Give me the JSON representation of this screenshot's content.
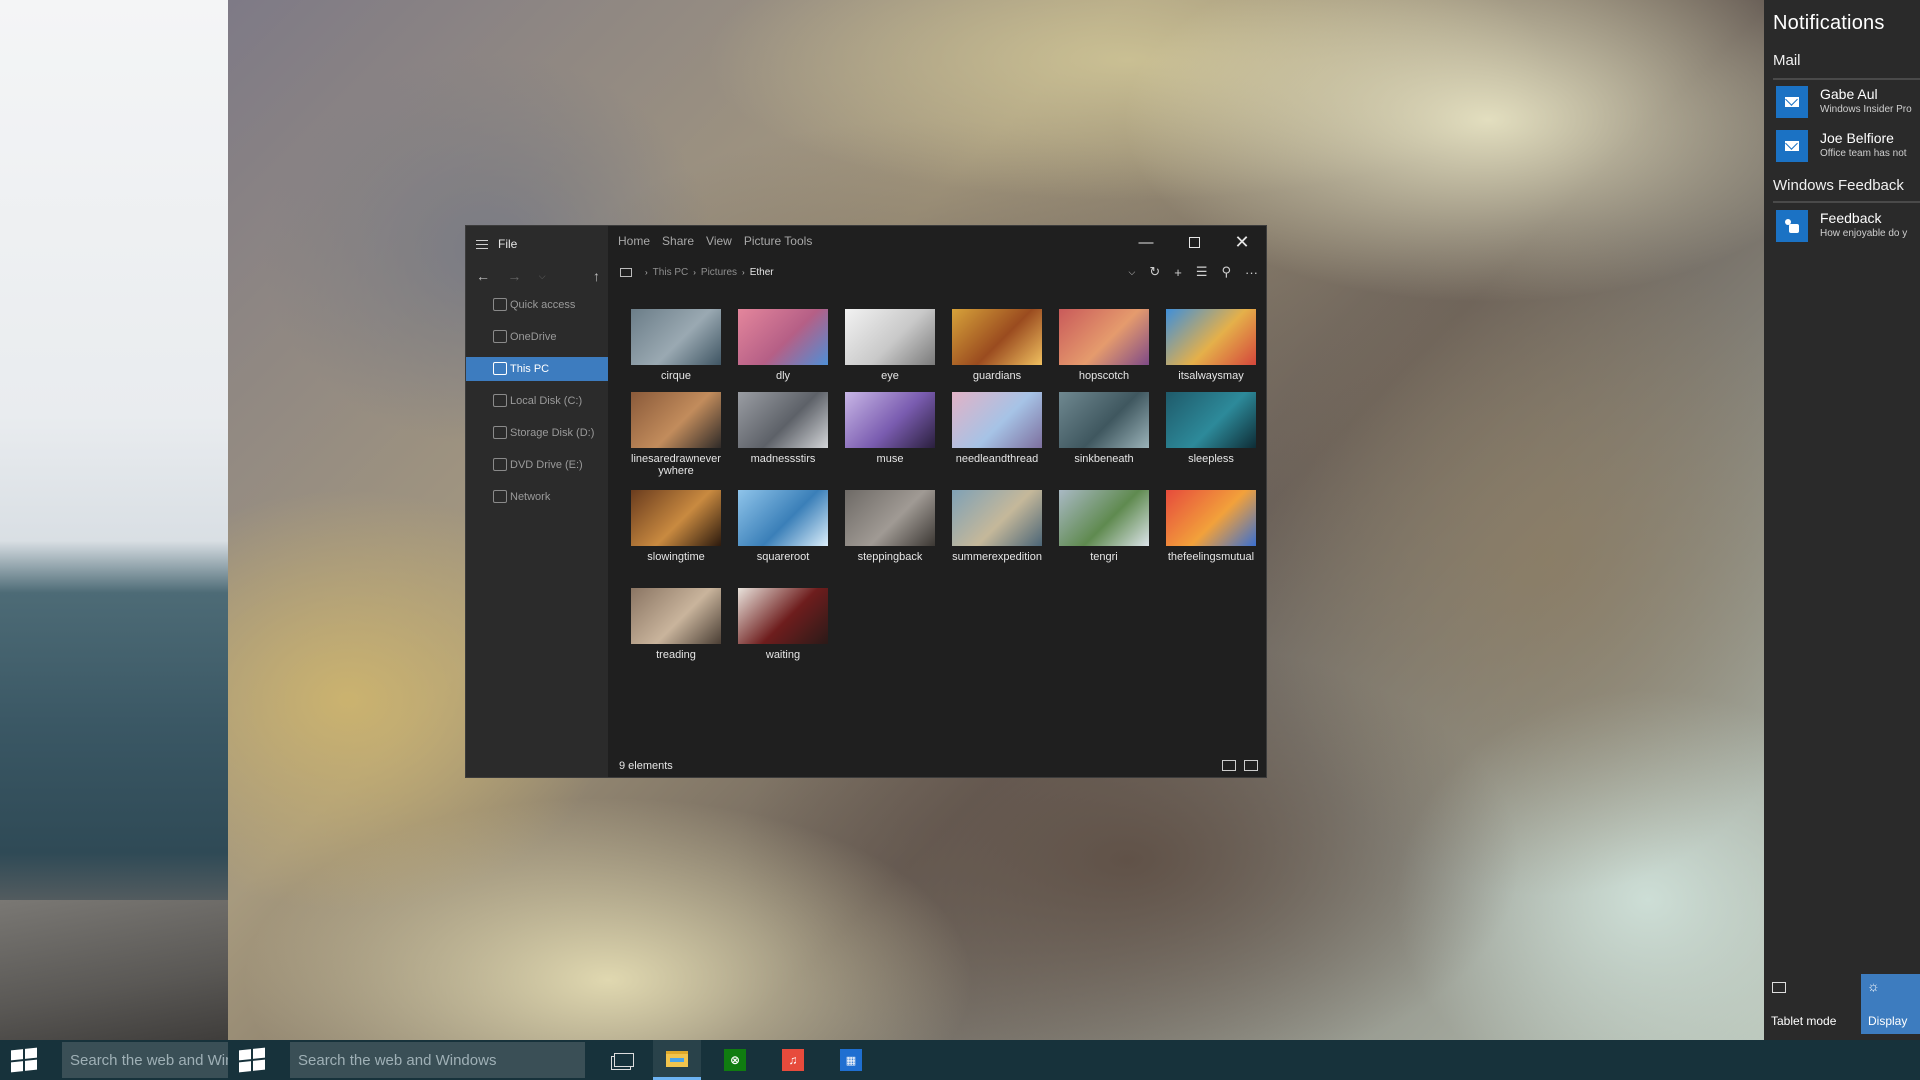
{
  "explorer": {
    "file_label": "File",
    "ribbon_tabs": [
      "Home",
      "Share",
      "View",
      "Picture Tools"
    ],
    "nav_items": [
      {
        "label": "Quick access",
        "icon": "lightning-icon"
      },
      {
        "label": "OneDrive",
        "icon": "cloud-icon"
      },
      {
        "label": "This PC",
        "icon": "monitor-icon",
        "selected": true
      },
      {
        "label": "Local Disk (C:)",
        "icon": "drive-icon"
      },
      {
        "label": "Storage Disk (D:)",
        "icon": "drive-icon"
      },
      {
        "label": "DVD Drive (E:)",
        "icon": "dvd-icon"
      },
      {
        "label": "Network",
        "icon": "network-icon"
      }
    ],
    "breadcrumb": [
      "This PC",
      "Pictures",
      "Ether"
    ],
    "files": [
      {
        "name": "cirque",
        "colors": [
          "#6b7d88",
          "#9aa9b2",
          "#3f5563"
        ]
      },
      {
        "name": "dly",
        "colors": [
          "#e4869c",
          "#b55f86",
          "#4f8fd6"
        ]
      },
      {
        "name": "eye",
        "colors": [
          "#f2f2f2",
          "#c9c9c9",
          "#7a7a7a"
        ]
      },
      {
        "name": "guardians",
        "colors": [
          "#d7a23a",
          "#9a4b1f",
          "#f0c060"
        ]
      },
      {
        "name": "hopscotch",
        "colors": [
          "#c95a5a",
          "#e59b6d",
          "#7f4a87"
        ]
      },
      {
        "name": "itsalwaysmay",
        "colors": [
          "#3f8fd9",
          "#e5b04a",
          "#d4463b"
        ]
      },
      {
        "name": "linesaredrawneverywhere",
        "colors": [
          "#8a5a3a",
          "#c28c5c",
          "#2f2a28"
        ]
      },
      {
        "name": "madnessstirs",
        "colors": [
          "#9a9da3",
          "#5d6168",
          "#d3d5d8"
        ]
      },
      {
        "name": "muse",
        "colors": [
          "#c8b6e6",
          "#7a5cb0",
          "#2a1f3d"
        ]
      },
      {
        "name": "needleandthread",
        "colors": [
          "#e2b2c6",
          "#a6c3e6",
          "#7d6f9e"
        ]
      },
      {
        "name": "sinkbeneath",
        "colors": [
          "#6f8890",
          "#3f575f",
          "#9bb3b9"
        ]
      },
      {
        "name": "sleepless",
        "colors": [
          "#1f5a6a",
          "#2d8a9a",
          "#0e2c35"
        ]
      },
      {
        "name": "slowingtime",
        "colors": [
          "#6a3c1e",
          "#c98a40",
          "#2c1a0e"
        ]
      },
      {
        "name": "squareroot",
        "colors": [
          "#8fc4ea",
          "#3a7fb8",
          "#dbeefa"
        ]
      },
      {
        "name": "steppingback",
        "colors": [
          "#6e6a66",
          "#a09a94",
          "#3b3733"
        ]
      },
      {
        "name": "summerexpedition",
        "colors": [
          "#7fa1b6",
          "#c5b89a",
          "#4b6577"
        ]
      },
      {
        "name": "tengri",
        "colors": [
          "#a9b9c4",
          "#5f8a4f",
          "#dbe3e8"
        ]
      },
      {
        "name": "thefeelingsmutual",
        "colors": [
          "#e64b3c",
          "#f2a13b",
          "#3a6fd0"
        ]
      },
      {
        "name": "treading",
        "colors": [
          "#8a7563",
          "#c9b49c",
          "#4a3e34"
        ]
      },
      {
        "name": "waiting",
        "colors": [
          "#e9e3dc",
          "#6e1d1d",
          "#2a1a18"
        ]
      }
    ],
    "status_text": "9 elements"
  },
  "notifications": {
    "title": "Notifications",
    "groups": [
      {
        "label": "Mail",
        "items": [
          {
            "title": "Gabe Aul",
            "subtitle": "Windows Insider Pro",
            "icon": "mail-icon"
          },
          {
            "title": "Joe Belfiore",
            "subtitle": "Office team has not",
            "icon": "mail-icon"
          }
        ]
      },
      {
        "label": "Windows Feedback",
        "items": [
          {
            "title": "Feedback",
            "subtitle": "How enjoyable do y",
            "icon": "feedback-icon"
          }
        ]
      }
    ],
    "quick_actions": [
      {
        "label": "Tablet mode",
        "icon": "tablet-mode-icon",
        "active": false
      },
      {
        "label": "Display",
        "icon": "brightness-icon",
        "active": true
      }
    ]
  },
  "taskbar": {
    "search_placeholder": "Search the web and Windows",
    "apps": [
      "task-view-icon",
      "file-explorer-icon",
      "xbox-icon",
      "groove-music-icon",
      "calculator-icon"
    ],
    "accent": "#17323b"
  }
}
